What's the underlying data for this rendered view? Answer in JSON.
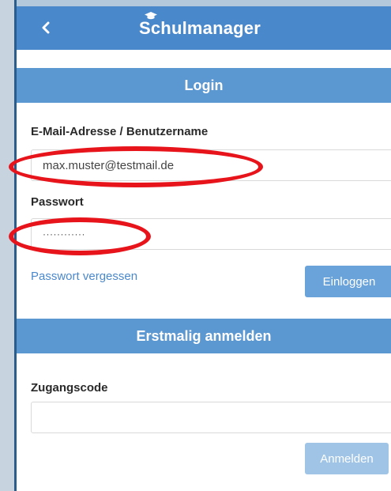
{
  "colors": {
    "appbar": "#4a88cc",
    "section_header": "#5b97d1",
    "button": "#6aa3d9",
    "button_disabled": "#9fc4e6",
    "link": "#4a88cc",
    "annotation": "#e8141b"
  },
  "header": {
    "title": "Schulmanager",
    "back_icon": "chevron-left-icon",
    "logo_icon": "graduation-cap-icon"
  },
  "login": {
    "section_title": "Login",
    "email_label": "E-Mail-Adresse / Benutzername",
    "email_value": "max.muster@testmail.de",
    "password_label": "Passwort",
    "password_value": "············",
    "forgot_link": "Passwort vergessen",
    "login_button": "Einloggen"
  },
  "register": {
    "section_title": "Erstmalig anmelden",
    "code_label": "Zugangscode",
    "code_value": "",
    "register_button": "Anmelden"
  },
  "annotations": [
    "highlight-ellipse",
    "highlight-ellipse"
  ]
}
